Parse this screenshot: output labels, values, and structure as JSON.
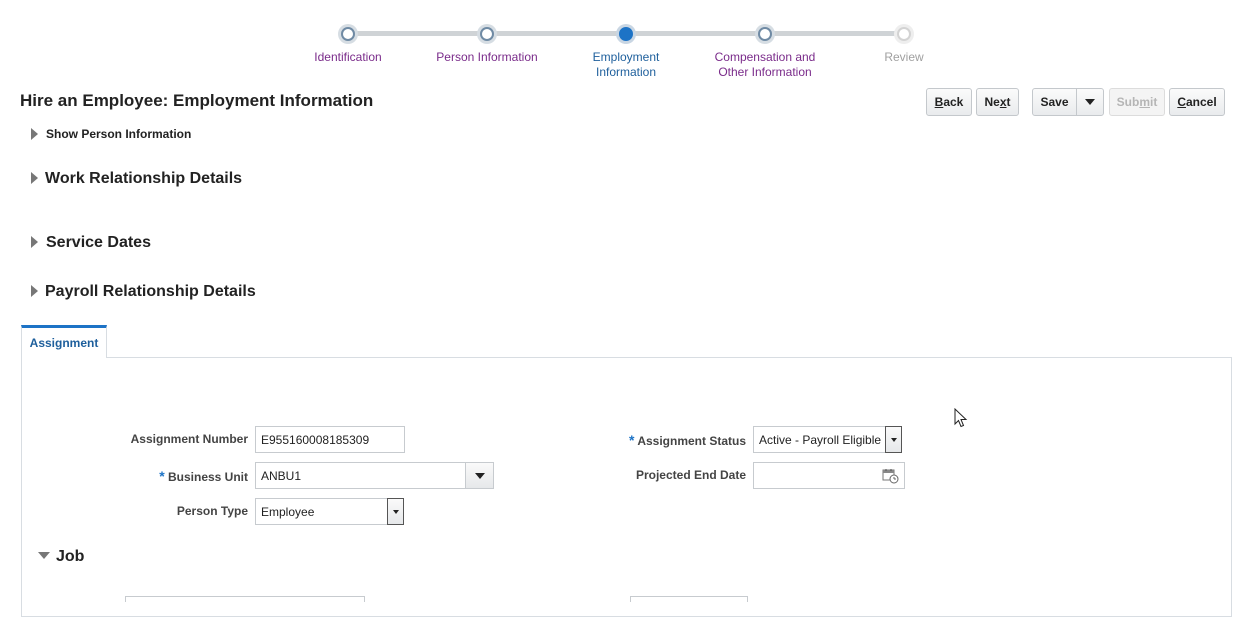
{
  "train": {
    "steps": [
      {
        "label": "Identification",
        "state": "done"
      },
      {
        "label": "Person Information",
        "state": "done"
      },
      {
        "label_line1": "Employment",
        "label_line2": "Information",
        "state": "current"
      },
      {
        "label_line1": "Compensation and",
        "label_line2": "Other Information",
        "state": "done"
      },
      {
        "label": "Review",
        "state": "future"
      }
    ]
  },
  "header": {
    "title": "Hire an Employee: Employment Information",
    "buttons": {
      "back_hot": "B",
      "back_rest": "ack",
      "next_pre": "Ne",
      "next_hot": "x",
      "next_post": "t",
      "save": "Save",
      "submit_pre": "Sub",
      "submit_hot": "m",
      "submit_post": "it",
      "cancel_hot": "C",
      "cancel_rest": "ancel"
    }
  },
  "sections": {
    "show_person_info": "Show Person Information",
    "work_relationship": "Work Relationship Details",
    "service_dates": "Service Dates",
    "payroll_relationship": "Payroll Relationship Details",
    "job": "Job"
  },
  "tabs": {
    "assignment": "Assignment"
  },
  "form": {
    "assignment_number": {
      "label": "Assignment Number",
      "value": "E955160008185309"
    },
    "business_unit": {
      "label": "Business Unit",
      "value": "ANBU1",
      "required": "*"
    },
    "person_type": {
      "label": "Person Type",
      "value": "Employee"
    },
    "assignment_status": {
      "label": "Assignment Status",
      "value": "Active - Payroll Eligible",
      "required": "*"
    },
    "projected_end_date": {
      "label": "Projected End Date",
      "value": ""
    }
  },
  "colors": {
    "accent": "#1d73c6",
    "visited_step": "#7a2b8a",
    "future_step": "#a0a0a0"
  }
}
